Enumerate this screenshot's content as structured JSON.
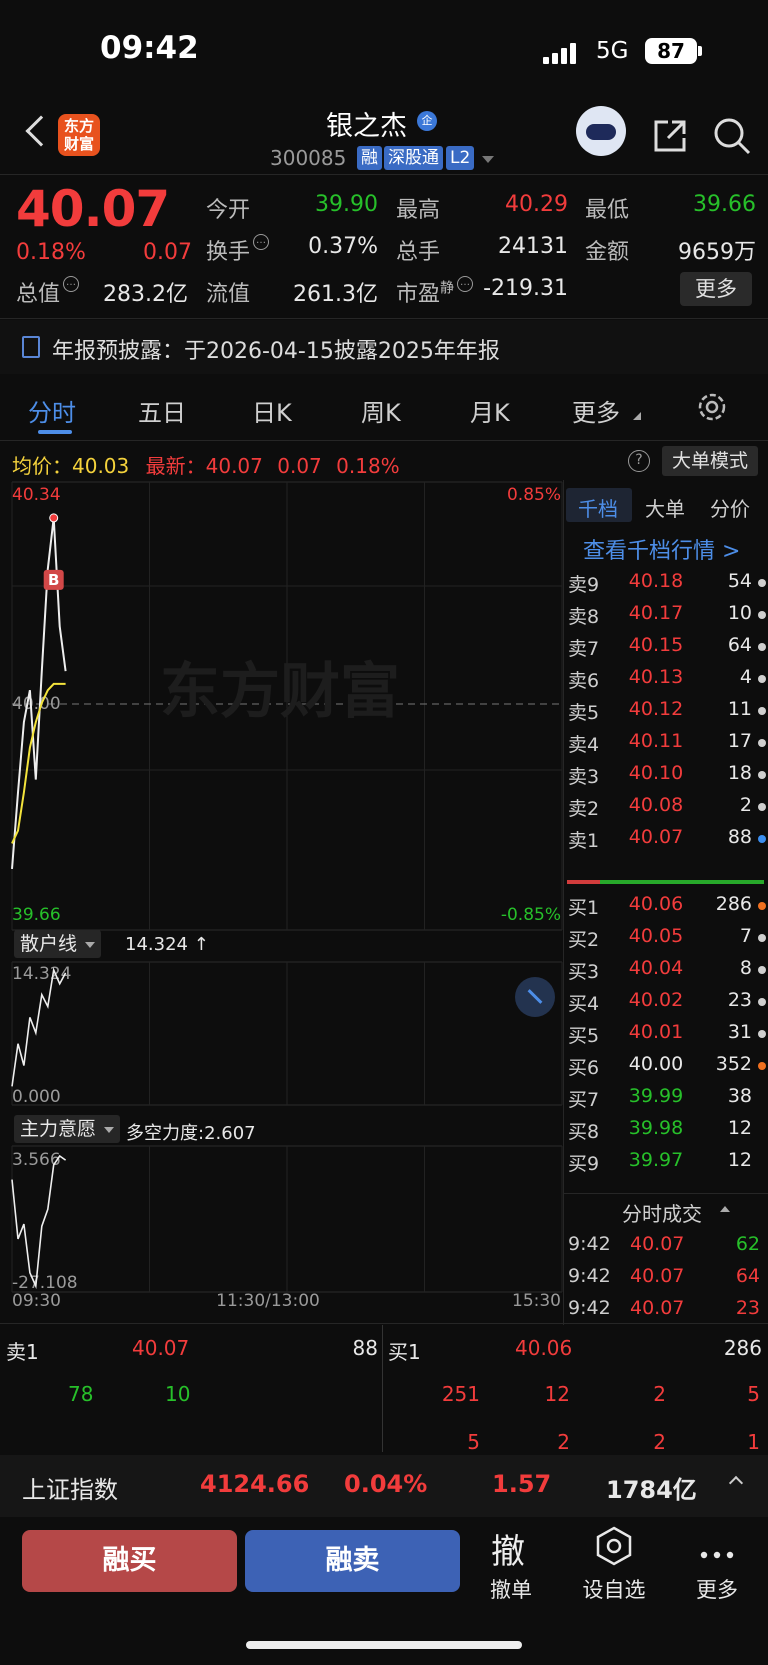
{
  "status_bar": {
    "time": "09:42",
    "network": "5G",
    "battery": "87"
  },
  "header": {
    "logo_text": "东方\n财富",
    "stock_name": "银之杰",
    "badge": "企",
    "stock_code": "300085",
    "tags": [
      "融",
      "深股通",
      "L2"
    ]
  },
  "quote": {
    "price": "40.07",
    "change_pct": "0.18%",
    "change": "0.07",
    "fields": [
      {
        "label": "今开",
        "value": "39.90",
        "color": "green"
      },
      {
        "label": "最高",
        "value": "40.29",
        "color": "red"
      },
      {
        "label": "最低",
        "value": "39.66",
        "color": "green"
      },
      {
        "label": "换手",
        "value": "0.37%",
        "color": "white"
      },
      {
        "label": "总手",
        "value": "24131",
        "color": "white"
      },
      {
        "label": "金额",
        "value": "9659万",
        "color": "white"
      },
      {
        "label": "总值",
        "value": "283.2亿",
        "color": "white"
      },
      {
        "label": "流值",
        "value": "261.3亿",
        "color": "white"
      },
      {
        "label": "市盈",
        "label_sup": "静",
        "value": "-219.31",
        "color": "white"
      }
    ],
    "more_label": "更多"
  },
  "notice": {
    "text": "年报预披露：于2026-04-15披露2025年年报"
  },
  "tabs": [
    "分时",
    "五日",
    "日K",
    "周K",
    "月K",
    "更多"
  ],
  "chart_header": {
    "avg_label": "均价：",
    "avg_value": "40.03",
    "latest_label": "最新：",
    "latest_value": "40.07",
    "latest_change": "0.07",
    "latest_pct": "0.18%",
    "help": "?",
    "mode_button": "大单模式"
  },
  "chart_data": [
    {
      "type": "line",
      "name": "intraday",
      "y_axis_left": {
        "max": "40.34",
        "mid": "40.00",
        "min": "39.66"
      },
      "y_axis_right": {
        "max": "0.85%",
        "min": "-0.85%"
      },
      "x_labels": [
        "09:30",
        "11:30/13:00",
        "15:30"
      ],
      "ylim": [
        39.66,
        40.34
      ],
      "price_series": [
        39.74,
        39.86,
        39.97,
        40.02,
        39.88,
        40.05,
        40.21,
        40.29,
        40.12,
        40.05
      ],
      "avg_series": [
        39.78,
        39.8,
        39.86,
        39.93,
        39.97,
        40.0,
        40.02,
        40.03,
        40.03,
        40.03
      ],
      "marker_label": "B",
      "watermark": "东方财富"
    },
    {
      "type": "line",
      "name": "散户线",
      "indicator_value": "14.324 ↑",
      "y_axis_left": {
        "max": "14.324",
        "min": "0.000"
      },
      "ylim": [
        0,
        14.324
      ],
      "series": [
        1.5,
        6.2,
        3.8,
        9.1,
        7.4,
        11.6,
        10.3,
        14.324,
        12.8,
        14.0
      ]
    },
    {
      "type": "line",
      "name": "主力意愿",
      "indicator_value": "多空力度:2.607",
      "y_axis_left": {
        "max": "3.566",
        "min": "-27.108"
      },
      "ylim": [
        -27.108,
        3.566
      ],
      "series": [
        -2.0,
        -16.0,
        -12.5,
        -24.0,
        -27.108,
        -13.0,
        -9.0,
        1.5,
        3.566,
        2.607
      ]
    }
  ],
  "order_book": {
    "tabs": [
      "千档",
      "大单",
      "分价"
    ],
    "link": "查看千档行情 >",
    "asks": [
      {
        "label": "卖9",
        "price": "40.18",
        "vol": "54",
        "color": "red",
        "dot": "#cfcfcf"
      },
      {
        "label": "卖8",
        "price": "40.17",
        "vol": "10",
        "color": "red",
        "dot": "#cfcfcf"
      },
      {
        "label": "卖7",
        "price": "40.15",
        "vol": "64",
        "color": "red",
        "dot": "#cfcfcf"
      },
      {
        "label": "卖6",
        "price": "40.13",
        "vol": "4",
        "color": "red",
        "dot": "#cfcfcf"
      },
      {
        "label": "卖5",
        "price": "40.12",
        "vol": "11",
        "color": "red",
        "dot": "#cfcfcf"
      },
      {
        "label": "卖4",
        "price": "40.11",
        "vol": "17",
        "color": "red",
        "dot": "#cfcfcf"
      },
      {
        "label": "卖3",
        "price": "40.10",
        "vol": "18",
        "color": "red",
        "dot": "#cfcfcf"
      },
      {
        "label": "卖2",
        "price": "40.08",
        "vol": "2",
        "color": "red",
        "dot": "#cfcfcf"
      },
      {
        "label": "卖1",
        "price": "40.07",
        "vol": "88",
        "color": "red",
        "dot": "#3b8ef0"
      }
    ],
    "bids": [
      {
        "label": "买1",
        "price": "40.06",
        "vol": "286",
        "color": "red",
        "dot": "#f07020"
      },
      {
        "label": "买2",
        "price": "40.05",
        "vol": "7",
        "color": "red",
        "dot": "#cfcfcf"
      },
      {
        "label": "买3",
        "price": "40.04",
        "vol": "8",
        "color": "red",
        "dot": "#cfcfcf"
      },
      {
        "label": "买4",
        "price": "40.02",
        "vol": "23",
        "color": "red",
        "dot": "#cfcfcf"
      },
      {
        "label": "买5",
        "price": "40.01",
        "vol": "31",
        "color": "red",
        "dot": "#cfcfcf"
      },
      {
        "label": "买6",
        "price": "40.00",
        "vol": "352",
        "color": "white",
        "dot": "#f07020"
      },
      {
        "label": "买7",
        "price": "39.99",
        "vol": "38",
        "color": "green",
        "dot": ""
      },
      {
        "label": "买8",
        "price": "39.98",
        "vol": "12",
        "color": "green",
        "dot": ""
      },
      {
        "label": "买9",
        "price": "39.97",
        "vol": "12",
        "color": "green",
        "dot": ""
      }
    ],
    "trades_header": "分时成交",
    "trades": [
      {
        "time": "9:42",
        "price": "40.07",
        "vol": "62",
        "vol_color": "green"
      },
      {
        "time": "9:42",
        "price": "40.07",
        "vol": "64",
        "vol_color": "red"
      },
      {
        "time": "9:42",
        "price": "40.07",
        "vol": "23",
        "vol_color": "red"
      }
    ]
  },
  "lower_panel": {
    "sell": {
      "label": "卖1",
      "price": "40.07",
      "vol": "88",
      "queue": [
        "78",
        "10"
      ]
    },
    "buy": {
      "label": "买1",
      "price": "40.06",
      "vol": "286",
      "queue_row1": [
        "251",
        "12",
        "2",
        "5"
      ],
      "queue_row2": [
        "5",
        "2",
        "2",
        "1"
      ]
    }
  },
  "index_bar": {
    "name": "上证指数",
    "value": "4124.66",
    "pct": "0.04%",
    "change": "1.57",
    "amount": "1784亿"
  },
  "bottom_bar": {
    "buy_label": "融买",
    "sell_label": "融卖",
    "cancel_glyph": "撤",
    "cancel_label": "撤单",
    "watchlist_label": "设自选",
    "more_label": "更多"
  }
}
